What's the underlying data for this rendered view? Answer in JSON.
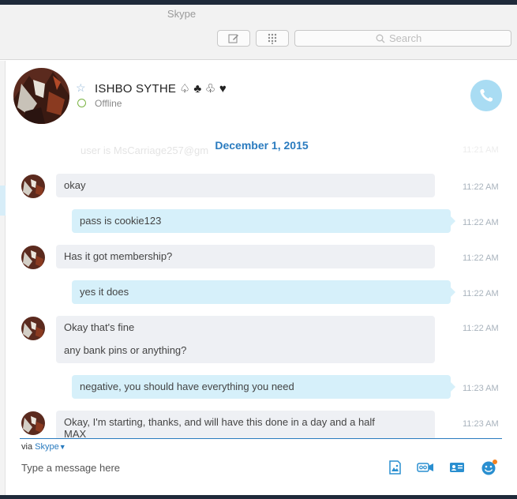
{
  "app": {
    "title": "Skype"
  },
  "toolbar": {
    "search_placeholder": "Search"
  },
  "contact": {
    "name": "ISHBO SYTHE ♤ ♣ ♧ ♥",
    "status": "Offline"
  },
  "chat": {
    "ghost_text": "user is MsCarriage257@gm",
    "ghost_time": "11:21 AM",
    "date_separator": "December 1, 2015",
    "messages": [
      {
        "direction": "in",
        "lines": [
          "okay"
        ],
        "time": "11:22 AM"
      },
      {
        "direction": "out",
        "lines": [
          "pass is cookie123"
        ],
        "time": "11:22 AM"
      },
      {
        "direction": "in",
        "lines": [
          "Has it got membership?"
        ],
        "time": "11:22 AM"
      },
      {
        "direction": "out",
        "lines": [
          "yes it does"
        ],
        "time": "11:22 AM"
      },
      {
        "direction": "in",
        "lines": [
          "Okay that's fine",
          "any bank pins or anything?"
        ],
        "time": "11:22 AM"
      },
      {
        "direction": "out",
        "lines": [
          "negative, you should have everything you need"
        ],
        "time": "11:23 AM"
      },
      {
        "direction": "in",
        "lines": [
          "Okay, I'm starting, thanks, and will have this done in a day and a half",
          "MAX"
        ],
        "time": "11:23 AM"
      }
    ]
  },
  "composer": {
    "via_label": "via",
    "via_link": "Skype",
    "placeholder": "Type a message here"
  },
  "colors": {
    "accent": "#2a7bbf",
    "outgoing_bubble": "#d6f0fa",
    "incoming_bubble": "#eef0f4",
    "call_button": "#a9dcf3",
    "online_ring": "#7ab342",
    "notification_dot": "#f5821f"
  }
}
